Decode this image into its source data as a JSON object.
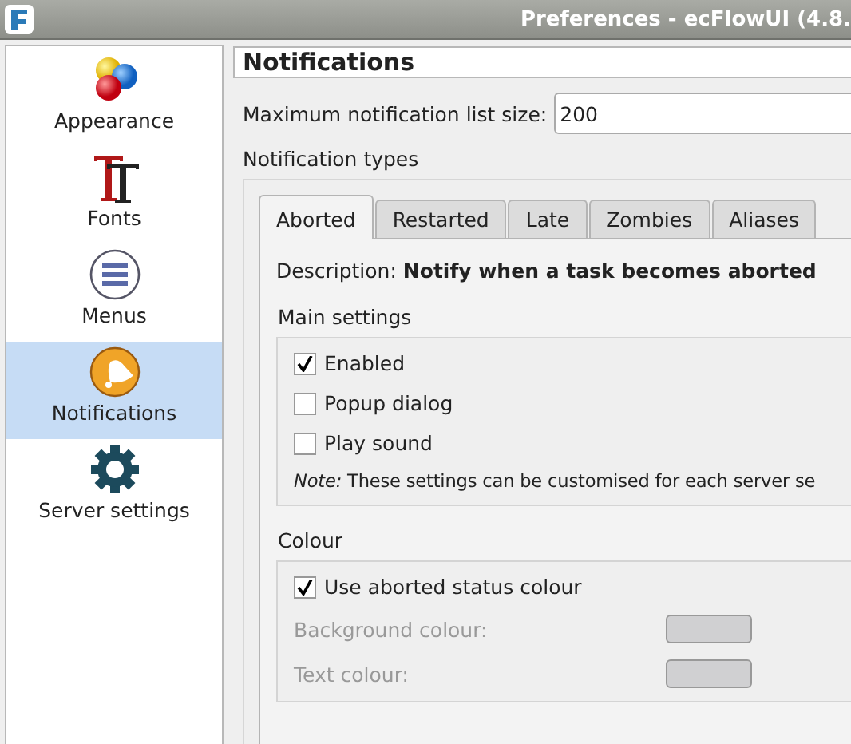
{
  "window": {
    "title": "Preferences - ecFlowUI (4.8."
  },
  "sidebar": {
    "items": [
      {
        "label": "Appearance",
        "kind": "balls",
        "selected": false
      },
      {
        "label": "Fonts",
        "kind": "fonts",
        "selected": false
      },
      {
        "label": "Menus",
        "kind": "menu",
        "selected": false
      },
      {
        "label": "Notifications",
        "kind": "bell",
        "selected": true
      },
      {
        "label": "Server settings",
        "kind": "gear",
        "selected": false
      }
    ]
  },
  "page": {
    "title": "Notifications",
    "max_list_size": {
      "label": "Maximum notification list size:",
      "value": "200"
    },
    "types_label": "Notification types",
    "tabs": [
      {
        "label": "Aborted",
        "selected": true
      },
      {
        "label": "Restarted",
        "selected": false
      },
      {
        "label": "Late",
        "selected": false
      },
      {
        "label": "Zombies",
        "selected": false
      },
      {
        "label": "Aliases",
        "selected": false
      }
    ],
    "description": "Description: **Notify when a task becomes aborted**",
    "main_settings": {
      "title": "Main settings",
      "options": [
        {
          "label": "Enabled",
          "checked": true
        },
        {
          "label": "Popup dialog",
          "checked": false
        },
        {
          "label": "Play sound",
          "checked": false
        }
      ],
      "note": "*Note:* These settings can be customised for each server se"
    },
    "colour": {
      "title": "Colour",
      "use_status": {
        "label": "Use aborted status colour",
        "checked": true
      },
      "fields": [
        {
          "label": "Background colour:",
          "disabled": true
        },
        {
          "label": "Text colour:",
          "disabled": true
        }
      ]
    }
  }
}
